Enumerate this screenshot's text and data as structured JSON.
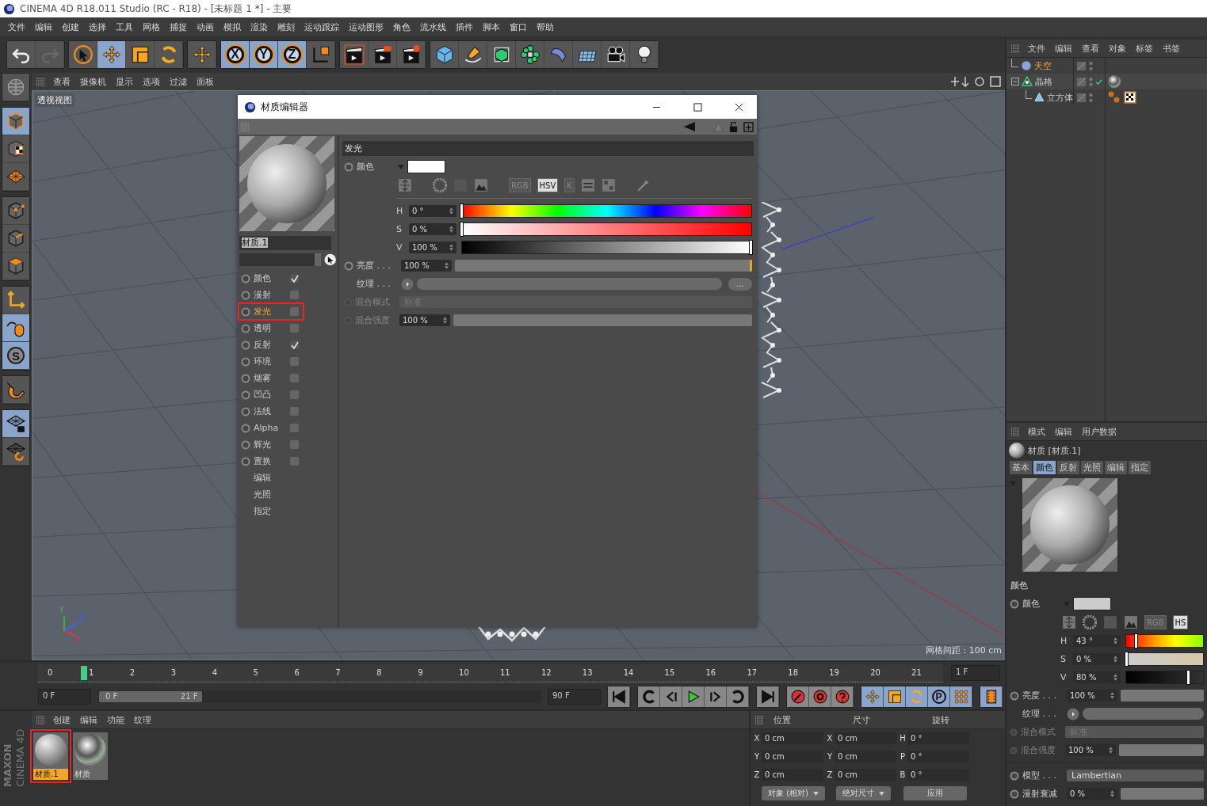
{
  "window": {
    "title": "CINEMA 4D R18.011 Studio (RC - R18) - [未标题 1 *] - 主要"
  },
  "menu": [
    "文件",
    "编辑",
    "创建",
    "选择",
    "工具",
    "网格",
    "捕捉",
    "动画",
    "模拟",
    "渲染",
    "雕刻",
    "运动跟踪",
    "运动图形",
    "角色",
    "流水线",
    "插件",
    "脚本",
    "窗口",
    "帮助"
  ],
  "toolbar": [
    [
      {
        "kind": "undo",
        "selected": false,
        "disabled": false
      },
      {
        "kind": "redo",
        "selected": false,
        "disabled": true
      }
    ],
    [
      {
        "kind": "select",
        "selected": false,
        "disabled": false
      },
      {
        "kind": "move",
        "selected": true,
        "disabled": false
      },
      {
        "kind": "scale",
        "selected": false,
        "disabled": false
      },
      {
        "kind": "rotate",
        "selected": false,
        "disabled": false
      }
    ],
    [
      {
        "kind": "add",
        "selected": false,
        "disabled": false
      }
    ],
    [
      {
        "kind": "axis",
        "label": "X",
        "selected": true,
        "disabled": false
      },
      {
        "kind": "axis",
        "label": "Y",
        "selected": true,
        "disabled": false
      },
      {
        "kind": "axis",
        "label": "Z",
        "selected": true,
        "disabled": false
      },
      {
        "kind": "coord",
        "selected": false,
        "disabled": false
      }
    ],
    [
      {
        "kind": "renderview",
        "selected": false,
        "disabled": false
      },
      {
        "kind": "renderpicture",
        "selected": false,
        "disabled": false
      },
      {
        "kind": "rendersettings",
        "selected": false,
        "disabled": false
      }
    ],
    [
      {
        "kind": "cube",
        "selected": false,
        "disabled": false
      },
      {
        "kind": "pen",
        "selected": false,
        "disabled": false
      },
      {
        "kind": "subdivision",
        "selected": false,
        "disabled": false
      },
      {
        "kind": "cloner",
        "selected": false,
        "disabled": false
      },
      {
        "kind": "deformer",
        "selected": false,
        "disabled": false
      },
      {
        "kind": "floor",
        "selected": false,
        "disabled": false
      },
      {
        "kind": "camera",
        "selected": false,
        "disabled": false
      },
      {
        "kind": "light",
        "selected": false,
        "disabled": false
      }
    ]
  ],
  "left_tools": [
    [
      {
        "kind": "display",
        "selected": false
      }
    ],
    [
      {
        "kind": "model",
        "selected": true
      },
      {
        "kind": "texture",
        "selected": false
      },
      {
        "kind": "workplane",
        "selected": false
      }
    ],
    [
      {
        "kind": "points",
        "selected": false
      },
      {
        "kind": "edges",
        "selected": false
      },
      {
        "kind": "polygons",
        "selected": false
      }
    ],
    [
      {
        "kind": "axismode",
        "selected": false
      },
      {
        "kind": "tweak",
        "selected": true
      },
      {
        "kind": "snap",
        "label": "S",
        "selected": true
      }
    ],
    [
      {
        "kind": "magnet",
        "selected": false
      }
    ],
    [
      {
        "kind": "lockplane",
        "selected": true
      },
      {
        "kind": "planerotate",
        "selected": false
      }
    ]
  ],
  "viewport": {
    "menu": [
      "查看",
      "摄像机",
      "显示",
      "选项",
      "过滤",
      "面板"
    ],
    "label": "透视视图",
    "grid_spacing": "网格间距 : 100 cm",
    "axis_labels": [
      "Y",
      "Z",
      "X"
    ]
  },
  "material_editor": {
    "title": "材质编辑器",
    "name": "材质.1",
    "channels": [
      {
        "kind": "channel",
        "label": "颜色",
        "checked": true,
        "selected": false
      },
      {
        "kind": "channel",
        "label": "漫射",
        "checked": false,
        "selected": false
      },
      {
        "kind": "channel",
        "label": "发光",
        "checked": false,
        "selected": true
      },
      {
        "kind": "channel",
        "label": "透明",
        "checked": false,
        "selected": false
      },
      {
        "kind": "channel",
        "label": "反射",
        "checked": true,
        "selected": false
      },
      {
        "kind": "channel",
        "label": "环境",
        "checked": false,
        "selected": false
      },
      {
        "kind": "channel",
        "label": "烟雾",
        "checked": false,
        "selected": false
      },
      {
        "kind": "channel",
        "label": "凹凸",
        "checked": false,
        "selected": false
      },
      {
        "kind": "channel",
        "label": "法线",
        "checked": false,
        "selected": false
      },
      {
        "kind": "channel",
        "label": "Alpha",
        "checked": false,
        "selected": false
      },
      {
        "kind": "channel",
        "label": "辉光",
        "checked": false,
        "selected": false
      },
      {
        "kind": "channel",
        "label": "置换",
        "checked": false,
        "selected": false
      },
      {
        "kind": "page",
        "label": "编辑",
        "selected": false
      },
      {
        "kind": "page",
        "label": "光照",
        "selected": false
      },
      {
        "kind": "page",
        "label": "指定",
        "selected": false
      }
    ],
    "section": "发光",
    "color_label": "颜色",
    "color": "#ffffff",
    "modes": [
      {
        "label": "RGB",
        "selected": false
      },
      {
        "label": "HSV",
        "selected": true
      },
      {
        "label": "K",
        "selected": false
      }
    ],
    "hsv": [
      {
        "label": "H",
        "value": "0 °",
        "level": 0
      },
      {
        "label": "S",
        "value": "0 %",
        "level": 0
      },
      {
        "label": "V",
        "value": "100 %",
        "level": 1
      }
    ],
    "brightness": {
      "label": "亮度 . . .",
      "value": "100 %",
      "level": 1
    },
    "texture": {
      "label": "纹理 . . .",
      "more": "..."
    },
    "blend_mode": {
      "label": "混合模式",
      "value": "标准"
    },
    "blend_strength": {
      "label": "混合强度",
      "value": "100 %"
    }
  },
  "object_manager": {
    "menu": [
      "文件",
      "编辑",
      "查看",
      "对象",
      "标签",
      "书签"
    ],
    "objects": [
      {
        "name": "天空",
        "kind": "sky",
        "selected": true
      },
      {
        "name": "晶格",
        "kind": "lattice",
        "selected": false,
        "expanded": true,
        "tags": [
          {
            "kind": "material"
          }
        ],
        "children": [
          {
            "name": "立方体",
            "kind": "cube",
            "selected": false,
            "tags": [
              {
                "kind": "phong"
              },
              {
                "kind": "texture"
              }
            ]
          }
        ]
      }
    ]
  },
  "attribute_manager": {
    "menu": [
      "模式",
      "编辑",
      "用户数据"
    ],
    "title": "材质 [材质.1]",
    "tabs": [
      {
        "label": "基本",
        "selected": false
      },
      {
        "label": "颜色",
        "selected": true
      },
      {
        "label": "反射",
        "selected": false
      },
      {
        "label": "光照",
        "selected": false
      },
      {
        "label": "编辑",
        "selected": false
      },
      {
        "label": "指定",
        "selected": false
      }
    ],
    "section": "颜色",
    "color_label": "颜色",
    "color": "#cccccc",
    "modes": [
      {
        "label": "RGB",
        "selected": false
      },
      {
        "label": "HS",
        "selected": true
      }
    ],
    "hsv": [
      {
        "label": "H",
        "value": "43 °",
        "level": 0.12
      },
      {
        "label": "S",
        "value": "0 %",
        "level": 0
      },
      {
        "label": "V",
        "value": "80 %",
        "level": 0.8
      }
    ],
    "brightness": {
      "label": "亮度 . . .",
      "value": "100 %"
    },
    "texture": {
      "label": "纹理 . . ."
    },
    "blend_mode": {
      "label": "混合模式",
      "value": "标准"
    },
    "blend_strength": {
      "label": "混合强度",
      "value": "100 %"
    },
    "model": {
      "label": "模型 . . .",
      "value": "Lambertian"
    },
    "falloff": {
      "label": "漫射衰减",
      "value": "0 %"
    }
  },
  "timeline": {
    "ticks": [
      "0",
      "1",
      "2",
      "3",
      "4",
      "5",
      "6",
      "7",
      "8",
      "9",
      "10",
      "11",
      "12",
      "13",
      "14",
      "15",
      "16",
      "17",
      "18",
      "19",
      "20",
      "21"
    ],
    "level": 0.0476,
    "current": "1 F"
  },
  "transport": {
    "start": "0 F",
    "range": {
      "start": "0 F",
      "end": "21 F",
      "level": 0.233
    },
    "end": "90 F",
    "keys": [
      {
        "kind": "move",
        "selected": true
      },
      {
        "kind": "scale",
        "selected": true
      },
      {
        "kind": "rotate",
        "selected": true
      },
      {
        "kind": "param",
        "label": "P",
        "selected": true
      },
      {
        "kind": "points",
        "selected": true
      }
    ]
  },
  "material_manager": {
    "menu": [
      "创建",
      "编辑",
      "功能",
      "纹理"
    ],
    "materials": [
      {
        "name": "材质.1",
        "kind": "matte",
        "selected": true
      },
      {
        "name": "材质",
        "kind": "chrome",
        "selected": false
      }
    ]
  },
  "coordinates": {
    "headers": [
      "位置",
      "尺寸",
      "旋转"
    ],
    "rows": [
      {
        "a": "X",
        "pos": "0 cm",
        "b": "X",
        "size": "0 cm",
        "c": "H",
        "rot": "0 °"
      },
      {
        "a": "Y",
        "pos": "0 cm",
        "b": "Y",
        "size": "0 cm",
        "c": "P",
        "rot": "0 °"
      },
      {
        "a": "Z",
        "pos": "0 cm",
        "b": "Z",
        "size": "0 cm",
        "c": "B",
        "rot": "0 °"
      }
    ],
    "mode": "对象 (相对)",
    "size_mode": "绝对尺寸",
    "apply": "应用"
  },
  "logo": [
    "MAXON",
    "CINEMA 4D"
  ]
}
